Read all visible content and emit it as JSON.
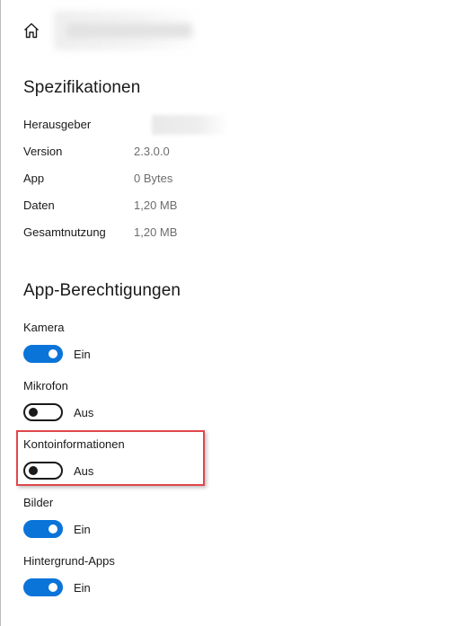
{
  "header": {
    "home_icon": "home-icon",
    "app_name_redacted": true
  },
  "specs": {
    "title": "Spezifikationen",
    "rows": [
      {
        "label": "Herausgeber",
        "value": "",
        "redacted": true
      },
      {
        "label": "Version",
        "value": "2.3.0.0"
      },
      {
        "label": "App",
        "value": "0 Bytes"
      },
      {
        "label": "Daten",
        "value": "1,20 MB"
      },
      {
        "label": "Gesamtnutzung",
        "value": "1,20 MB"
      }
    ]
  },
  "permissions": {
    "title": "App-Berechtigungen",
    "items": [
      {
        "label": "Kamera",
        "state": "Ein",
        "on": true
      },
      {
        "label": "Mikrofon",
        "state": "Aus",
        "on": false
      },
      {
        "label": "Kontoinformationen",
        "state": "Aus",
        "on": false,
        "highlighted": true
      },
      {
        "label": "Bilder",
        "state": "Ein",
        "on": true
      },
      {
        "label": "Hintergrund-Apps",
        "state": "Ein",
        "on": true
      }
    ]
  },
  "colors": {
    "toggle_on": "#0a74d8",
    "highlight": "#e0474c",
    "value_text": "#6d6d6d"
  }
}
